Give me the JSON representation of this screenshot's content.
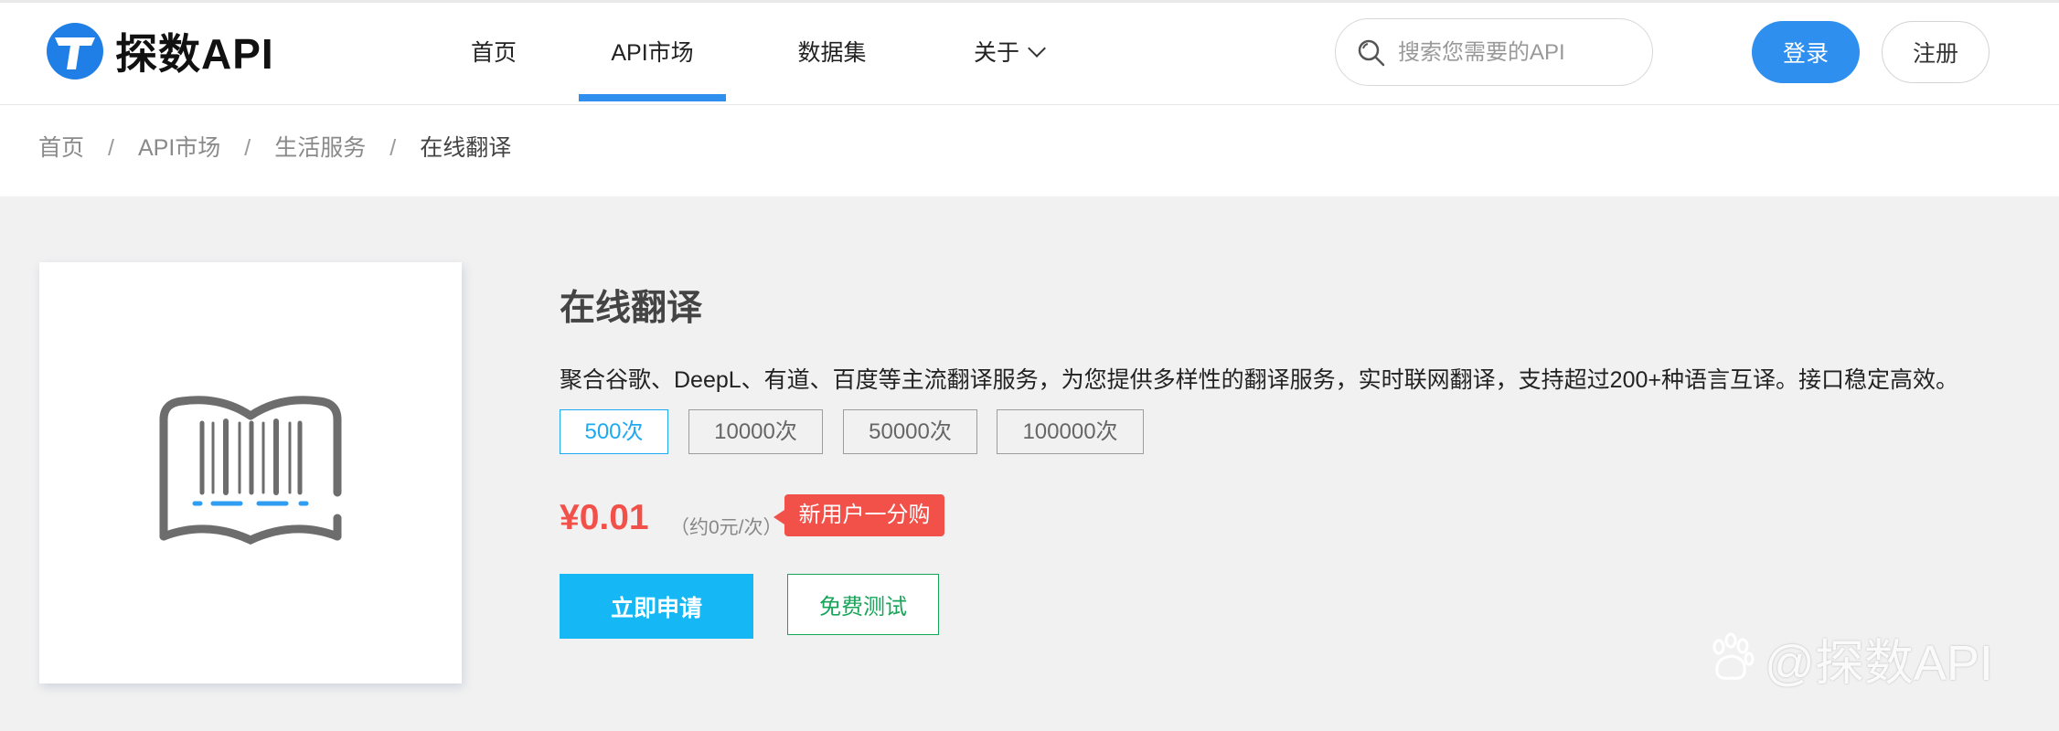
{
  "header": {
    "logo_text": "探数API",
    "nav": [
      {
        "label": "首页"
      },
      {
        "label": "API市场",
        "active": true
      },
      {
        "label": "数据集"
      },
      {
        "label": "关于"
      }
    ],
    "search_placeholder": "搜索您需要的API",
    "login_label": "登录",
    "register_label": "注册"
  },
  "breadcrumb": {
    "items": [
      "首页",
      "API市场",
      "生活服务"
    ],
    "separator": "/",
    "current": "在线翻译"
  },
  "product": {
    "title": "在线翻译",
    "description": "聚合谷歌、DeepL、有道、百度等主流翻译服务，为您提供多样性的翻译服务，实时联网翻译，支持超过200+种语言互译。接口稳定高效。",
    "options": [
      {
        "label": "500次",
        "selected": true
      },
      {
        "label": "10000次"
      },
      {
        "label": "50000次"
      },
      {
        "label": "100000次"
      }
    ],
    "price": "¥0.01",
    "unit_price": "（约0元/次）",
    "badge": "新用户一分购",
    "apply_label": "立即申请",
    "test_label": "免费测试"
  },
  "watermark": {
    "text": "@探数API"
  },
  "colors": {
    "primary_blue": "#2f8fee",
    "apply_cyan": "#15b7f5",
    "price_red": "#f2514a",
    "test_green": "#18a55a",
    "selected_option": "#1eaaf1"
  }
}
